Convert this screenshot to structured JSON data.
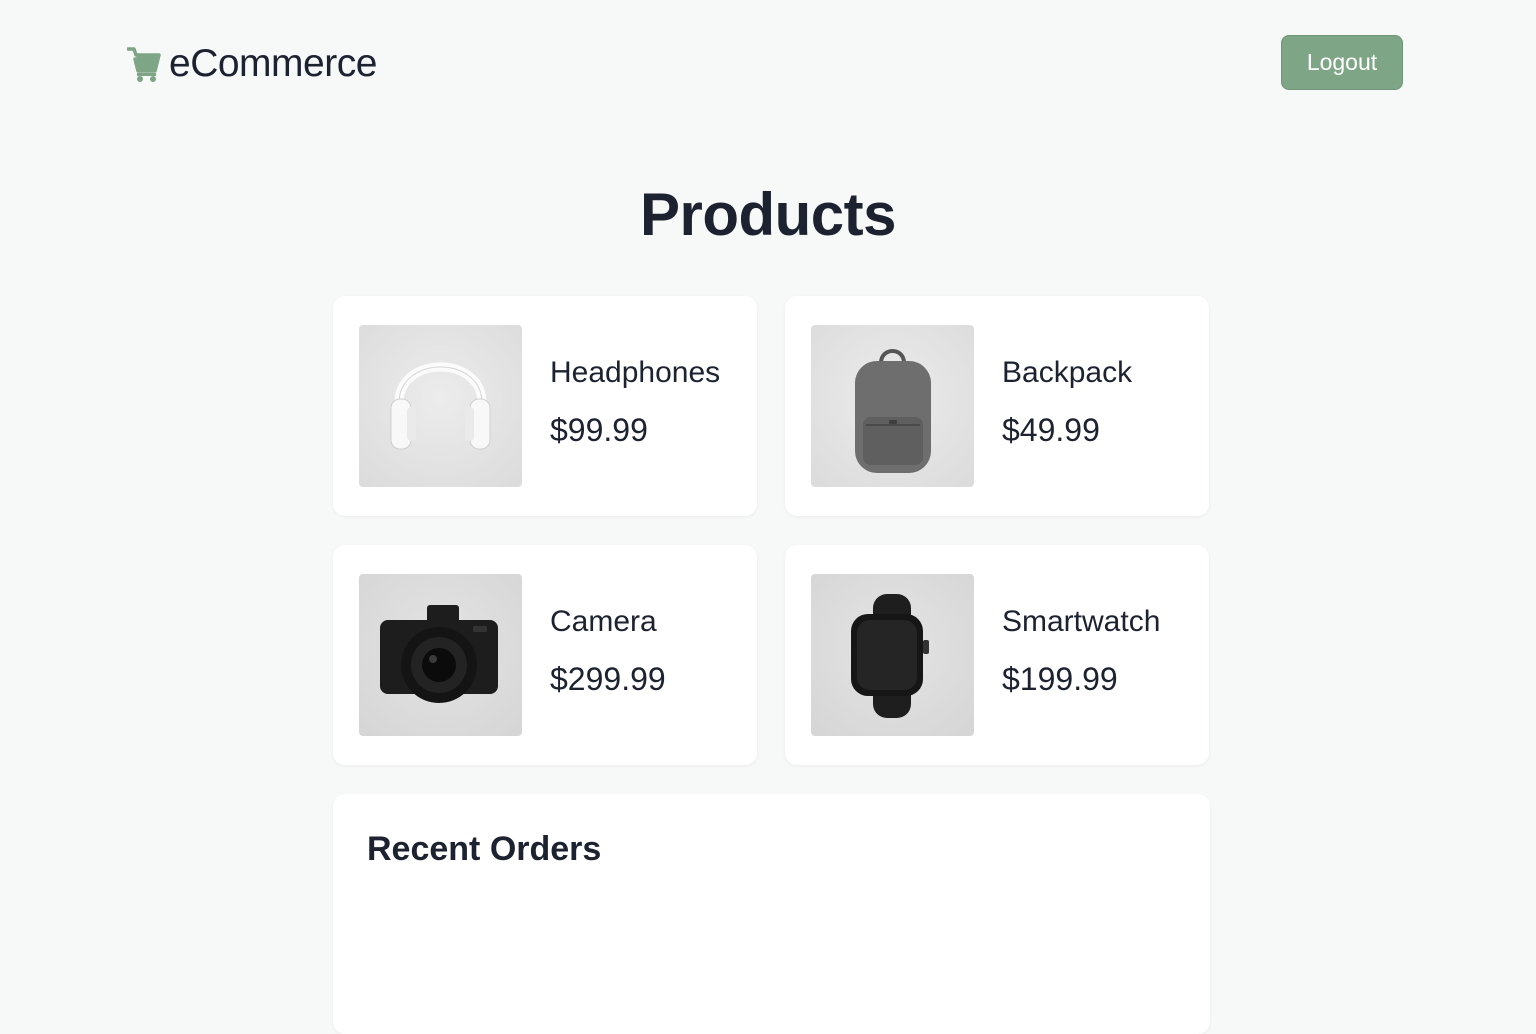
{
  "header": {
    "brand_name": "eCommerce",
    "brand_icon": "shopping-cart-icon",
    "logout_label": "Logout"
  },
  "colors": {
    "accent": "#7ea586",
    "text": "#1c2230",
    "background": "#f7f8f8",
    "card": "#ffffff"
  },
  "main": {
    "title": "Products",
    "products": [
      {
        "name": "Headphones",
        "price": "$99.99",
        "image": "headphones-image"
      },
      {
        "name": "Backpack",
        "price": "$49.99",
        "image": "backpack-image"
      },
      {
        "name": "Camera",
        "price": "$299.99",
        "image": "camera-image"
      },
      {
        "name": "Smartwatch",
        "price": "$199.99",
        "image": "smartwatch-image"
      }
    ],
    "orders_title": "Recent Orders"
  }
}
